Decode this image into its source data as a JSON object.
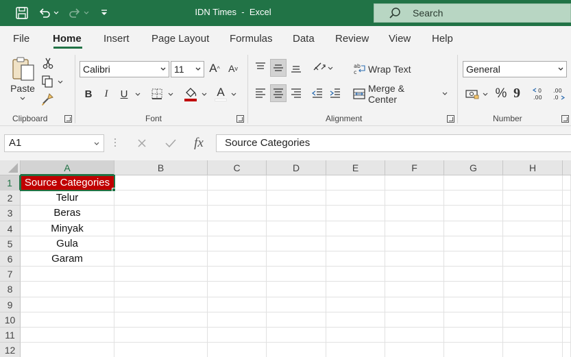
{
  "titlebar": {
    "doc_name": "IDN Times",
    "separator": "-",
    "app_name": "Excel",
    "search_placeholder": "Search"
  },
  "menu": {
    "tabs": [
      "File",
      "Home",
      "Insert",
      "Page Layout",
      "Formulas",
      "Data",
      "Review",
      "View",
      "Help"
    ],
    "active_tab": "Home"
  },
  "ribbon": {
    "clipboard": {
      "paste_label": "Paste",
      "group_label": "Clipboard"
    },
    "font": {
      "font_name": "Calibri",
      "font_size": "11",
      "bold": "B",
      "italic": "I",
      "underline": "U",
      "grow": "A",
      "shrink": "A",
      "font_color_glyph": "A",
      "group_label": "Font"
    },
    "alignment": {
      "wrap_text": "Wrap Text",
      "merge_center": "Merge & Center",
      "group_label": "Alignment"
    },
    "number": {
      "format": "General",
      "percent": "%",
      "comma": "9",
      "group_label": "Number"
    }
  },
  "formula_bar": {
    "name_box": "A1",
    "fx": "fx",
    "formula": "Source Categories"
  },
  "sheet": {
    "columns": [
      "A",
      "B",
      "C",
      "D",
      "E",
      "F",
      "G",
      "H"
    ],
    "rows": [
      "1",
      "2",
      "3",
      "4",
      "5",
      "6",
      "7",
      "8",
      "9",
      "10",
      "11",
      "12"
    ],
    "selected_cell": "A1",
    "column_a": [
      "Source Categories",
      "Telur",
      "Beras",
      "Minyak",
      "Gula",
      "Garam",
      "",
      "",
      "",
      "",
      "",
      ""
    ],
    "colors": {
      "header_fill": "#c00000",
      "header_text": "#ffffff",
      "accent": "#217346"
    }
  }
}
